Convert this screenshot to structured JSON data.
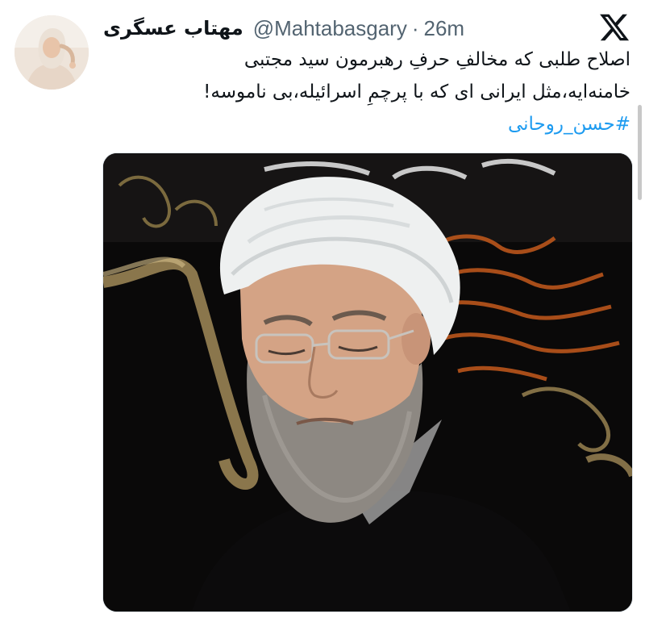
{
  "tweet": {
    "display_name": "مهتاب عسگری",
    "handle": "@Mahtabasgary",
    "separator": "·",
    "time": "26m",
    "text_lines": [
      "اصلاح طلبی که مخالفِ حرفِ رهبرمون سید مجتبی",
      "خامنه‌ایه،مثل ایرانی ای که با پرچمِ اسرائیله،بی ناموسه!"
    ],
    "hashtag": "#حسن_روحانی"
  },
  "icons": {
    "platform_logo": "x-logo-icon",
    "avatar": "profile-photo",
    "media": "cleric-photo"
  },
  "colors": {
    "text": "#0f1419",
    "muted": "#536471",
    "link": "#1d9bf0"
  }
}
